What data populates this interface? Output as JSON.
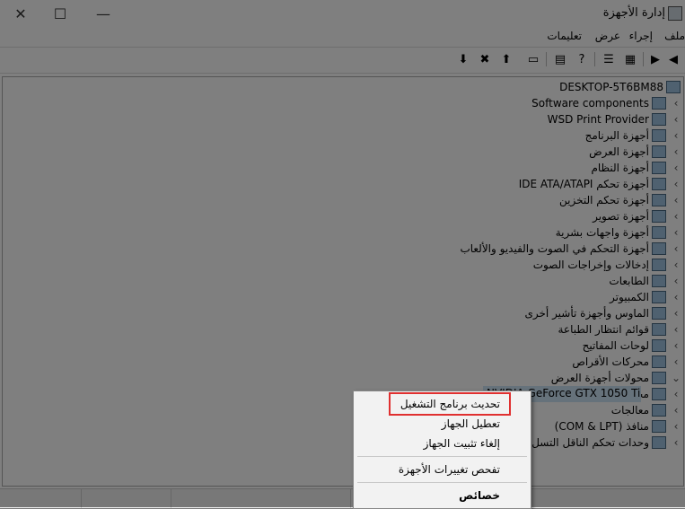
{
  "window": {
    "title": "إدارة الأجهزة",
    "close_glyph": "✕",
    "maximize_glyph": "☐",
    "minimize_glyph": "—"
  },
  "menubar": {
    "items": [
      "ملف",
      "إجراء",
      "عرض",
      "تعليمات"
    ]
  },
  "toolbar": {
    "icons": [
      "back-icon",
      "forward-icon",
      "show-hide-tree-icon",
      "properties-icon",
      "help-icon",
      "action-pane-icon",
      "monitor-icon",
      "update-driver-icon",
      "uninstall-icon",
      "enable-device-icon"
    ]
  },
  "tree": {
    "root": "DESKTOP-5T6BM88",
    "nodes": [
      {
        "label": "Software components",
        "expanded": false
      },
      {
        "label": "WSD Print Provider",
        "expanded": false
      },
      {
        "label": "أجهزة البرنامج",
        "expanded": false
      },
      {
        "label": "أجهزة العرض",
        "expanded": false
      },
      {
        "label": "أجهزة النظام",
        "expanded": false
      },
      {
        "label": "IDE ATA/ATAPI أجهزة تحكم",
        "expanded": false
      },
      {
        "label": "أجهزة تحكم التخزين",
        "expanded": false
      },
      {
        "label": "أجهزة تصوير",
        "expanded": false
      },
      {
        "label": "أجهزة واجهات بشرية",
        "expanded": false
      },
      {
        "label": "أجهزة التحكم في الصوت والفيديو والألعاب",
        "expanded": false
      },
      {
        "label": "إدخالات وإخراجات الصوت",
        "expanded": false
      },
      {
        "label": "الطابعات",
        "expanded": false
      },
      {
        "label": "الكمبيوتر",
        "expanded": false
      },
      {
        "label": "الماوس وأجهزة تأشير أخرى",
        "expanded": false
      },
      {
        "label": "قوائم انتظار الطباعة",
        "expanded": false
      },
      {
        "label": "لوحات المفاتيح",
        "expanded": false
      },
      {
        "label": "محركات الأقراص",
        "expanded": false
      },
      {
        "label": "محولات أجهزة العرض",
        "expanded": true
      },
      {
        "label": "محولات الشبكة",
        "expanded": false
      },
      {
        "label": "معالجات",
        "expanded": false
      },
      {
        "label": "منافذ (COM & LPT)",
        "expanded": false
      },
      {
        "label": "وحدات تحكم الناقل التسل",
        "expanded": false
      }
    ],
    "selected_child": "NVIDIA GeForce GTX 1050 Ti"
  },
  "context_menu": {
    "items": [
      {
        "label": "تحديث برنامج التشغيل",
        "bold": false
      },
      {
        "label": "تعطيل الجهاز",
        "bold": false
      },
      {
        "label": "إلغاء تثبيت الجهاز",
        "bold": false
      },
      {
        "label": "تفحص تغييرات الأجهزة",
        "bold": false
      },
      {
        "label": "خصائص",
        "bold": true
      }
    ],
    "highlight_color": "#e03030"
  }
}
